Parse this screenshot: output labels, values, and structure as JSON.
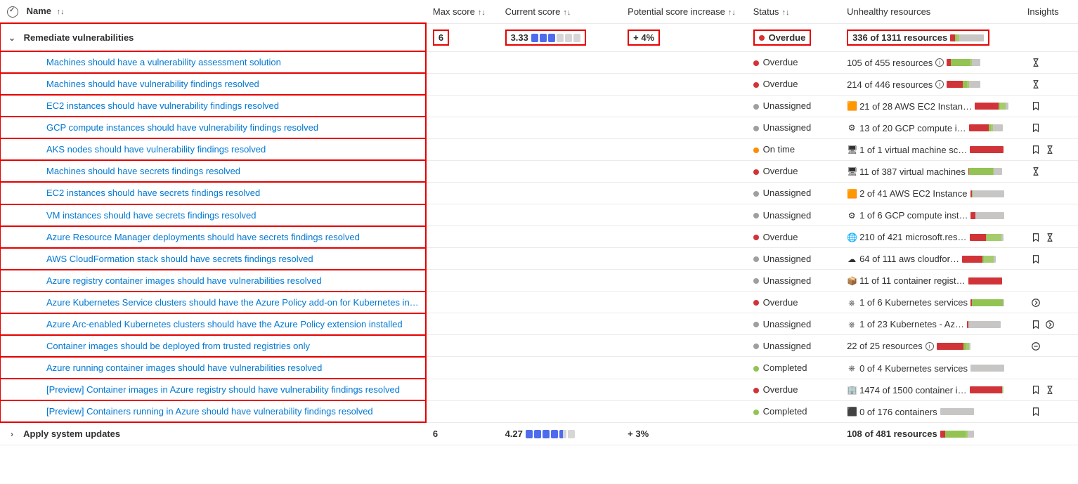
{
  "columns": {
    "name": "Name",
    "max": "Max score",
    "cur": "Current score",
    "pot": "Potential score increase",
    "status": "Status",
    "unh": "Unhealthy resources",
    "ins": "Insights"
  },
  "group": {
    "name": "Remediate vulnerabilities",
    "max": "6",
    "cur": "3.33",
    "cur_bars": [
      1,
      1,
      1,
      0,
      0,
      0
    ],
    "pot": "+ 4%",
    "status_dot": "red",
    "status": "Overdue",
    "unh": "336 of 1311 resources",
    "bar": [
      14,
      4,
      8,
      74
    ]
  },
  "rows": [
    {
      "name": "Machines should have a vulnerability assessment solution",
      "status_dot": "red",
      "status": "Overdue",
      "icon": "",
      "unh": "105 of 455 resources",
      "info": true,
      "bar": [
        12,
        56,
        6,
        26
      ],
      "insights": [
        "hourglass"
      ]
    },
    {
      "name": "Machines should have vulnerability findings resolved",
      "status_dot": "red",
      "status": "Overdue",
      "icon": "",
      "unh": "214 of 446 resources",
      "info": true,
      "bar": [
        48,
        12,
        6,
        34
      ],
      "insights": [
        "hourglass"
      ]
    },
    {
      "name": "EC2 instances should have vulnerability findings resolved",
      "status_dot": "gray",
      "status": "Unassigned",
      "icon": "aws",
      "unh": "21 of 28 AWS EC2 Instan…",
      "info": false,
      "bar": [
        70,
        4,
        18,
        8
      ],
      "insights": [
        "bookmark"
      ]
    },
    {
      "name": "GCP compute instances should have vulnerability findings resolved",
      "status_dot": "gray",
      "status": "Unassigned",
      "icon": "gcp",
      "unh": "13 of 20 GCP compute i…",
      "info": false,
      "bar": [
        60,
        6,
        6,
        28
      ],
      "insights": [
        "bookmark"
      ]
    },
    {
      "name": "AKS nodes should have vulnerability findings resolved",
      "status_dot": "orange",
      "status": "On time",
      "icon": "vmss",
      "unh": "1 of 1 virtual machine sc…",
      "info": false,
      "bar": [
        100,
        0,
        0,
        0
      ],
      "insights": [
        "bookmark",
        "hourglass"
      ]
    },
    {
      "name": "Machines should have secrets findings resolved",
      "status_dot": "red",
      "status": "Overdue",
      "icon": "vm",
      "unh": "11 of 387 virtual machines",
      "info": false,
      "bar": [
        3,
        70,
        2,
        25
      ],
      "insights": [
        "hourglass"
      ]
    },
    {
      "name": "EC2 instances should have secrets findings resolved",
      "status_dot": "gray",
      "status": "Unassigned",
      "icon": "aws",
      "unh": "2 of 41 AWS EC2 Instance",
      "info": false,
      "bar": [
        6,
        2,
        0,
        92
      ],
      "insights": []
    },
    {
      "name": "VM instances should have secrets findings resolved",
      "status_dot": "gray",
      "status": "Unassigned",
      "icon": "gcp",
      "unh": "1 of 6 GCP compute inst…",
      "info": false,
      "bar": [
        14,
        0,
        0,
        86
      ],
      "insights": []
    },
    {
      "name": "Azure Resource Manager deployments should have secrets findings resolved",
      "status_dot": "red",
      "status": "Overdue",
      "icon": "arm",
      "unh": "210 of 421 microsoft.res…",
      "info": false,
      "bar": [
        48,
        2,
        44,
        6
      ],
      "insights": [
        "bookmark",
        "hourglass"
      ]
    },
    {
      "name": "AWS CloudFormation stack should have secrets findings resolved",
      "status_dot": "gray",
      "status": "Unassigned",
      "icon": "cloud",
      "unh": "64 of 111 aws cloudfor…",
      "info": false,
      "bar": [
        60,
        4,
        30,
        6
      ],
      "insights": [
        "bookmark"
      ]
    },
    {
      "name": "Azure registry container images should have vulnerabilities resolved",
      "status_dot": "gray",
      "status": "Unassigned",
      "icon": "acr",
      "unh": "11 of 11 container regist…",
      "info": false,
      "bar": [
        100,
        0,
        0,
        0
      ],
      "insights": []
    },
    {
      "name": "Azure Kubernetes Service clusters should have the Azure Policy add-on for Kubernetes in…",
      "status_dot": "red",
      "status": "Overdue",
      "icon": "k8s",
      "unh": "1 of 6 Kubernetes services",
      "info": false,
      "bar": [
        4,
        92,
        0,
        4
      ],
      "insights": [
        "circlechev"
      ]
    },
    {
      "name": "Azure Arc-enabled Kubernetes clusters should have the Azure Policy extension installed",
      "status_dot": "gray",
      "status": "Unassigned",
      "icon": "k8s",
      "unh": "1 of 23 Kubernetes - Az…",
      "info": false,
      "bar": [
        4,
        0,
        0,
        96
      ],
      "insights": [
        "bookmark",
        "circlechev"
      ]
    },
    {
      "name": "Container images should be deployed from trusted registries only",
      "status_dot": "gray",
      "status": "Unassigned",
      "icon": "",
      "unh": "22 of 25 resources",
      "info": true,
      "bar": [
        80,
        8,
        8,
        4
      ],
      "insights": [
        "minus"
      ]
    },
    {
      "name": "Azure running container images should have vulnerabilities resolved",
      "status_dot": "green",
      "status": "Completed",
      "icon": "k8s",
      "unh": "0 of 4 Kubernetes services",
      "info": false,
      "bar": [
        0,
        0,
        0,
        100
      ],
      "insights": []
    },
    {
      "name": "[Preview] Container images in Azure registry should have vulnerability findings resolved",
      "status_dot": "red",
      "status": "Overdue",
      "icon": "acrp",
      "unh": "1474 of 1500 container i…",
      "info": false,
      "bar": [
        96,
        0,
        2,
        2
      ],
      "insights": [
        "bookmark",
        "hourglass"
      ]
    },
    {
      "name": "[Preview] Containers running in Azure should have vulnerability findings resolved",
      "status_dot": "green",
      "status": "Completed",
      "icon": "cont",
      "unh": "0 of 176 containers",
      "info": false,
      "bar": [
        0,
        0,
        0,
        100
      ],
      "insights": [
        "bookmark"
      ]
    }
  ],
  "group2": {
    "name": "Apply system updates",
    "max": "6",
    "cur": "4.27",
    "cur_bars": [
      1,
      1,
      1,
      1,
      0.5,
      0
    ],
    "pot": "+ 3%",
    "unh": "108 of 481 resources",
    "bar": [
      16,
      60,
      6,
      18
    ]
  },
  "icons": {
    "aws": "🟧",
    "gcp": "⚙",
    "vmss": "🖥",
    "vm": "🖥",
    "arm": "🌐",
    "cloud": "☁",
    "acr": "📦",
    "k8s": "⎈",
    "acrp": "🏢",
    "cont": "⬛"
  }
}
